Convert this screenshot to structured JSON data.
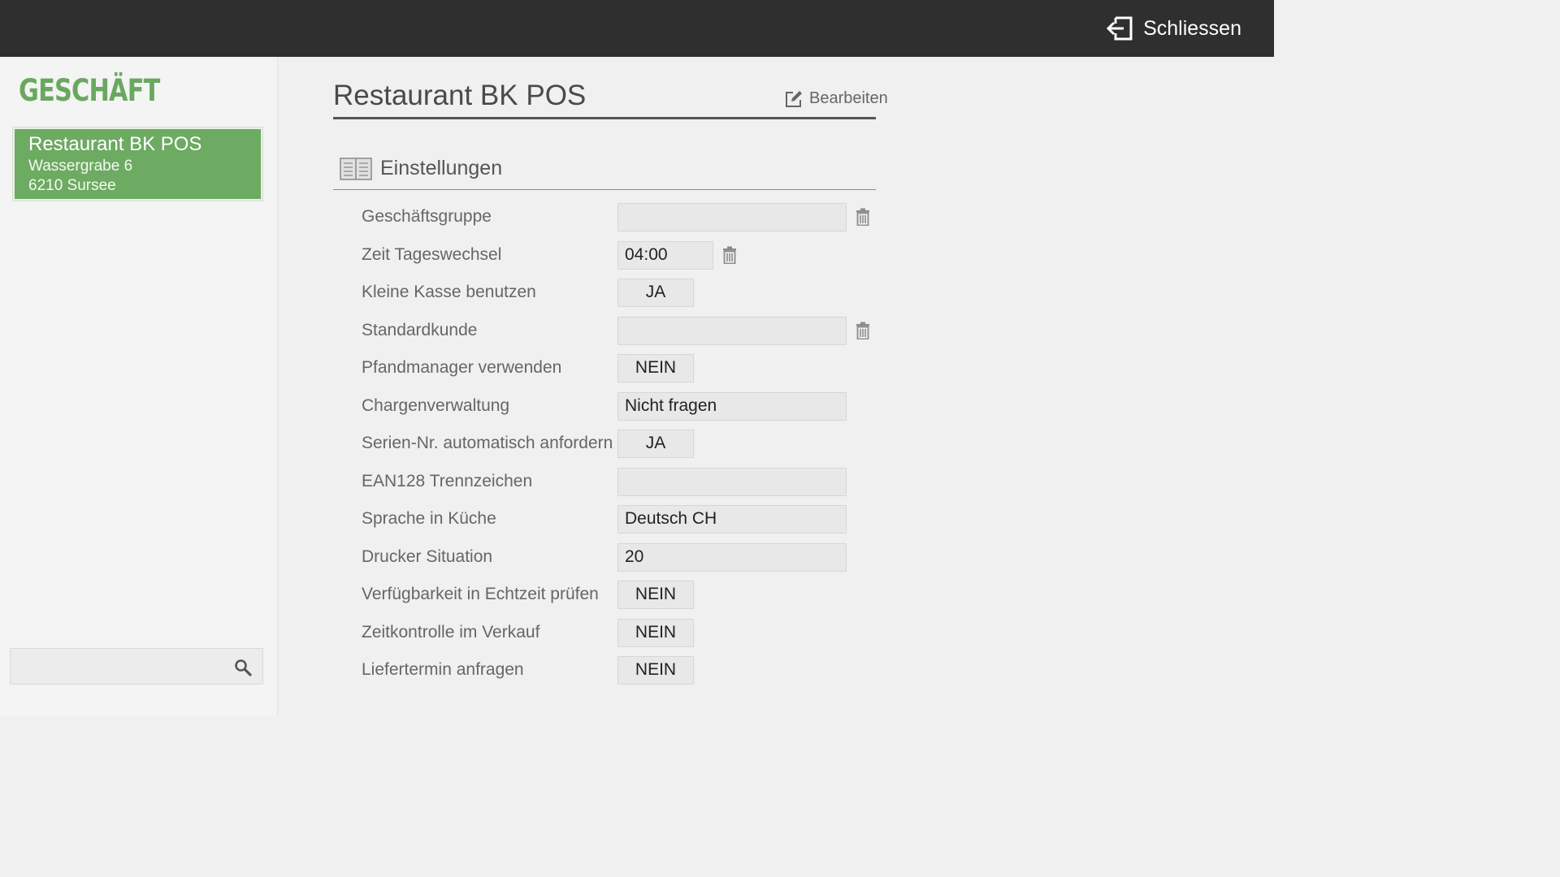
{
  "header": {
    "close_label": "Schliessen",
    "close_icon": "exit-icon"
  },
  "sidebar": {
    "title": "GESCHÄFT",
    "store": {
      "name": "Restaurant BK POS",
      "street": "Wassergrabe 6",
      "city": "6210 Sursee"
    },
    "search": {
      "value": "",
      "icon": "search-icon"
    }
  },
  "main": {
    "title": "Restaurant BK POS",
    "edit_label": "Bearbeiten",
    "edit_icon": "edit-icon",
    "section": {
      "label": "Einstellungen",
      "icon": "book-icon"
    },
    "settings": [
      {
        "label": "Geschäftsgruppe",
        "value": ""
      },
      {
        "label": "Zeit Tageswechsel",
        "value": "04:00"
      },
      {
        "label": "Kleine Kasse benutzen",
        "value": "JA"
      },
      {
        "label": "Standardkunde",
        "value": ""
      },
      {
        "label": "Pfandmanager verwenden",
        "value": "NEIN"
      },
      {
        "label": "Chargenverwaltung",
        "value": "Nicht fragen"
      },
      {
        "label": "Serien-Nr. automatisch anfordern",
        "value": "JA"
      },
      {
        "label": "EAN128 Trennzeichen",
        "value": ""
      },
      {
        "label": "Sprache in Küche",
        "value": "Deutsch CH"
      },
      {
        "label": "Drucker Situation",
        "value": "20"
      },
      {
        "label": "Verfügbarkeit in Echtzeit prüfen",
        "value": "NEIN"
      },
      {
        "label": "Zeitkontrolle im Verkauf",
        "value": "NEIN"
      },
      {
        "label": "Liefertermin anfragen",
        "value": "NEIN"
      }
    ]
  },
  "colors": {
    "topbar": "#2f2f2f",
    "accent_green": "#6aa860",
    "card_green": "#6daa62"
  }
}
